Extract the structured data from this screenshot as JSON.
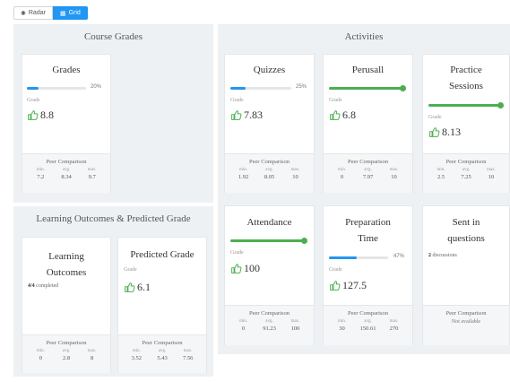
{
  "view_toggle": {
    "radar": "Radar",
    "grid": "Grid"
  },
  "course_grades": {
    "title": "Course Grades",
    "grades": {
      "title": "Grades",
      "percent_text": "20%",
      "progress": 0.2,
      "grade_label": "Grade",
      "value": "8.8",
      "peer": {
        "title": "Peer Comparison",
        "min_label": "min.",
        "avg_label": "avg.",
        "max_label": "max.",
        "min": "7.2",
        "avg": "8.34",
        "max": "9.7"
      }
    }
  },
  "learning": {
    "title": "Learning Outcomes & Predicted Grade",
    "outcomes": {
      "title": "Learning Outcomes",
      "completed_count": "4/4",
      "completed_text": "completed",
      "peer": {
        "title": "Peer Comparison",
        "min_label": "min.",
        "avg_label": "avg.",
        "max_label": "max.",
        "min": "0",
        "avg": "2.8",
        "max": "8"
      }
    },
    "predicted": {
      "title": "Predicted Grade",
      "grade_label": "Grade",
      "value": "6.1",
      "peer": {
        "title": "Peer Comparison",
        "min_label": "min.",
        "avg_label": "avg.",
        "max_label": "max.",
        "min": "3.52",
        "avg": "5.43",
        "max": "7.56"
      }
    }
  },
  "activities": {
    "title": "Activities",
    "quizzes": {
      "title": "Quizzes",
      "percent_text": "25%",
      "progress": 0.25,
      "grade_label": "Grade",
      "value": "7.83",
      "peer": {
        "title": "Peer Comparison",
        "min_label": "min.",
        "avg_label": "avg.",
        "max_label": "max.",
        "min": "1.92",
        "avg": "8.05",
        "max": "10"
      }
    },
    "perusall": {
      "title": "Perusall",
      "progress": 1.0,
      "grade_label": "Grade",
      "value": "6.8",
      "peer": {
        "title": "Peer Comparison",
        "min_label": "min.",
        "avg_label": "avg.",
        "max_label": "max.",
        "min": "0",
        "avg": "7.97",
        "max": "10"
      }
    },
    "practice": {
      "title": "Practice Sessions",
      "progress": 1.0,
      "grade_label": "Grade",
      "value": "8.13",
      "peer": {
        "title": "Peer Comparison",
        "min_label": "min.",
        "avg_label": "avg.",
        "max_label": "max.",
        "min": "2.5",
        "avg": "7.25",
        "max": "10"
      }
    },
    "attendance": {
      "title": "Attendance",
      "progress": 1.0,
      "grade_label": "Grade",
      "value": "100",
      "peer": {
        "title": "Peer Comparison",
        "min_label": "min.",
        "avg_label": "avg.",
        "max_label": "max.",
        "min": "0",
        "avg": "91.23",
        "max": "100"
      }
    },
    "prep": {
      "title": "Preparation Time",
      "percent_text": "47%",
      "progress": 0.47,
      "grade_label": "Grade",
      "value": "127.5",
      "peer": {
        "title": "Peer Comparison",
        "min_label": "min.",
        "avg_label": "avg.",
        "max_label": "max.",
        "min": "30",
        "avg": "150.61",
        "max": "270"
      }
    },
    "sent": {
      "title": "Sent in questions",
      "count": "2",
      "count_text": "discussions",
      "peer": {
        "title": "Peer Comparison",
        "not_available": "Not available"
      }
    }
  },
  "colors": {
    "accent": "#2196f3",
    "success": "#4caf50",
    "thumb": "#4caf50",
    "panel": "#eef1f4"
  }
}
